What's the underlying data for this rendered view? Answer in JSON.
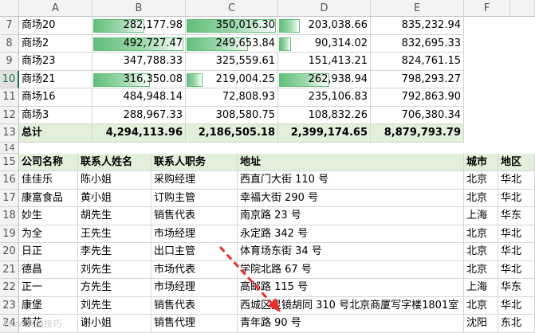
{
  "columns": [
    "",
    "A",
    "B",
    "C",
    "D",
    "E",
    "F"
  ],
  "top_rows": [
    {
      "row": "7",
      "name": "商场20",
      "b": "282,177.98",
      "c": "350,016.30",
      "d": "203,038.66",
      "e": "835,232.94",
      "bb": 0.57,
      "bc": 1.0,
      "bd": 0.23
    },
    {
      "row": "8",
      "name": "商场2",
      "b": "492,727.47",
      "c": "249,653.84",
      "d": "90,314.02",
      "e": "832,695.33",
      "bb": 1.0,
      "bc": 0.69,
      "bd": 0.13
    },
    {
      "row": "9",
      "name": "商场23",
      "b": "347,788.33",
      "c": "325,559.61",
      "d": "151,413.21",
      "e": "824,761.15",
      "bb": 0,
      "bc": 0,
      "bd": 0
    },
    {
      "row": "10",
      "name": "商场21",
      "b": "316,350.08",
      "c": "219,004.25",
      "d": "262,938.94",
      "e": "798,293.27",
      "bb": 0.63,
      "bc": 0.18,
      "bd": 0.56
    },
    {
      "row": "11",
      "name": "商场16",
      "b": "484,948.14",
      "c": "72,808.93",
      "d": "235,106.83",
      "e": "792,863.90",
      "bb": 0,
      "bc": 0,
      "bd": 0
    },
    {
      "row": "12",
      "name": "商场3",
      "b": "288,967.33",
      "c": "308,580.75",
      "d": "108,832.26",
      "e": "706,380.34",
      "bb": 0,
      "bc": 0,
      "bd": 0
    }
  ],
  "total_row": {
    "row": "13",
    "name": "总计",
    "b": "4,294,113.96",
    "c": "2,186,505.18",
    "d": "2,399,174.65",
    "e": "8,879,793.79"
  },
  "row14": "14",
  "table_header": {
    "row": "15",
    "company": "公司名称",
    "contact": "联系人姓名",
    "title": "联系人职务",
    "address": "地址",
    "city": "城市",
    "region": "地区"
  },
  "table_rows": [
    {
      "row": "16",
      "company": "佳佳乐",
      "contact": "陈小姐",
      "title": "采购经理",
      "address": "西直门大街 110 号",
      "city": "北京",
      "region": "华北"
    },
    {
      "row": "17",
      "company": "康富食品",
      "contact": "黄小姐",
      "title": "订购主管",
      "address": "幸福大街 290 号",
      "city": "北京",
      "region": "华北"
    },
    {
      "row": "18",
      "company": "妙生",
      "contact": "胡先生",
      "title": "销售代表",
      "address": "南京路 23 号",
      "city": "上海",
      "region": "华东"
    },
    {
      "row": "19",
      "company": "为全",
      "contact": "王先生",
      "title": "市场经理",
      "address": "永定路 342 号",
      "city": "北京",
      "region": "华北"
    },
    {
      "row": "20",
      "company": "日正",
      "contact": "李先生",
      "title": "出口主管",
      "address": "体育场东街 34 号",
      "city": "北京",
      "region": "华北"
    },
    {
      "row": "21",
      "company": "德昌",
      "contact": "刘先生",
      "title": "市场代表",
      "address": "学院北路 67 号",
      "city": "北京",
      "region": "华北"
    },
    {
      "row": "22",
      "company": "正一",
      "contact": "方先生",
      "title": "市场经理",
      "address": "高邮路 115 号",
      "city": "上海",
      "region": "华东"
    },
    {
      "row": "23",
      "company": "康堡",
      "contact": "刘先生",
      "title": "销售代表",
      "address": "西城区灵镜胡同 310 号北京商厦写字楼1801室",
      "city": "北京",
      "region": "华北"
    },
    {
      "row": "24",
      "company": "菊花",
      "contact": "谢小姐",
      "title": "销售代理",
      "address": "青年路 90 号",
      "city": "沈阳",
      "region": "东北"
    }
  ],
  "watermark": "Excel实战技巧",
  "colors": {
    "bar": "#63be7b",
    "total_fill": "#e2efda",
    "arrow": "#e8302a",
    "row_select": "#217346"
  }
}
